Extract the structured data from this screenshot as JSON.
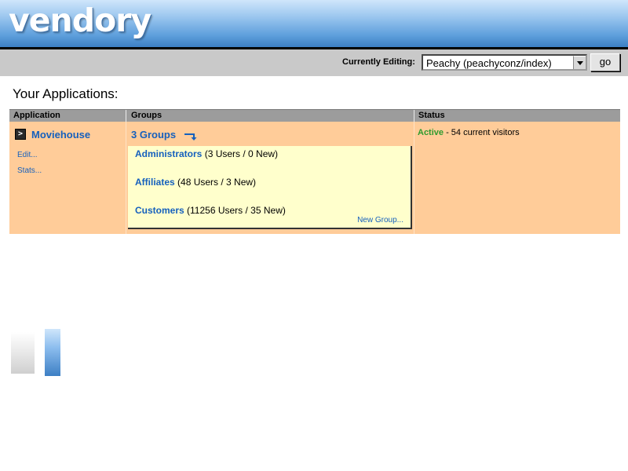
{
  "header": {
    "logo": "vendory"
  },
  "editbar": {
    "label": "Currently Editing:",
    "selected_app": "Peachy (peachyconz/index)",
    "go_label": "go"
  },
  "page_title": "Your Applications:",
  "table": {
    "columns": [
      "Application",
      "Groups",
      "Status"
    ],
    "rows": [
      {
        "application": {
          "icon": "terminal-icon",
          "icon_glyph": ">",
          "name": "Moviehouse",
          "links": [
            "Edit...",
            "Stats..."
          ]
        },
        "groups": {
          "toggle_label": "3 Groups",
          "items": [
            {
              "name": "Administrators",
              "detail": "(3 Users / 0 New)"
            },
            {
              "name": "Affiliates",
              "detail": "(48 Users / 3 New)"
            },
            {
              "name": "Customers",
              "detail": "(11256 Users / 35 New)"
            }
          ],
          "new_group_label": "New Group..."
        },
        "status": {
          "state": "Active",
          "detail": " - 54 current visitors"
        }
      }
    ]
  },
  "colors": {
    "link": "#1560bd",
    "active": "#2e9b2e",
    "row_background": "#ffcc99",
    "groups_panel": "#ffffcc"
  }
}
